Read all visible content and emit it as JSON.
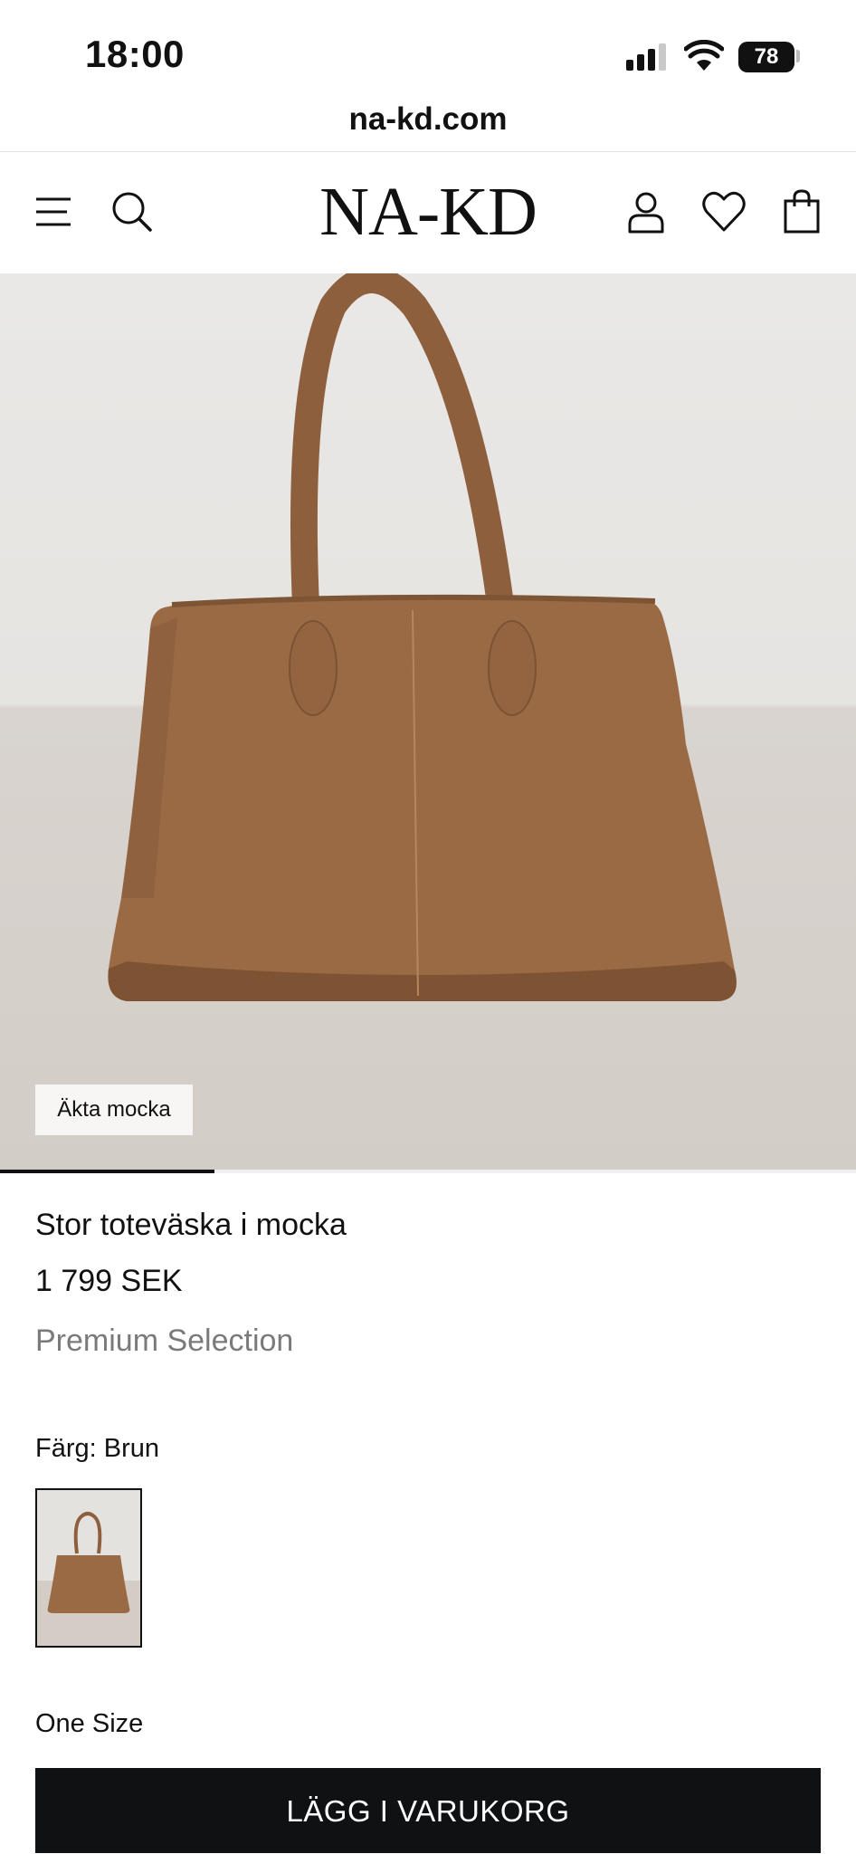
{
  "status_bar": {
    "time": "18:00",
    "battery": "78"
  },
  "browser": {
    "url": "na-kd.com"
  },
  "header": {
    "logo": "NA-KD",
    "icons": [
      "menu-icon",
      "search-icon",
      "account-icon",
      "heart-icon",
      "bag-icon"
    ]
  },
  "product": {
    "badge": "Äkta mocka",
    "title": "Stor toteväska i mocka",
    "price": "1 799 SEK",
    "collection": "Premium Selection",
    "color_label": "Färg: Brun",
    "size_label": "One Size",
    "add_to_cart": "LÄGG I VARUKORG",
    "gallery_progress": 0.25
  },
  "colors": {
    "accent": "#0f1113",
    "bag": "#9a6a45",
    "muted_text": "#7a7a7a"
  }
}
